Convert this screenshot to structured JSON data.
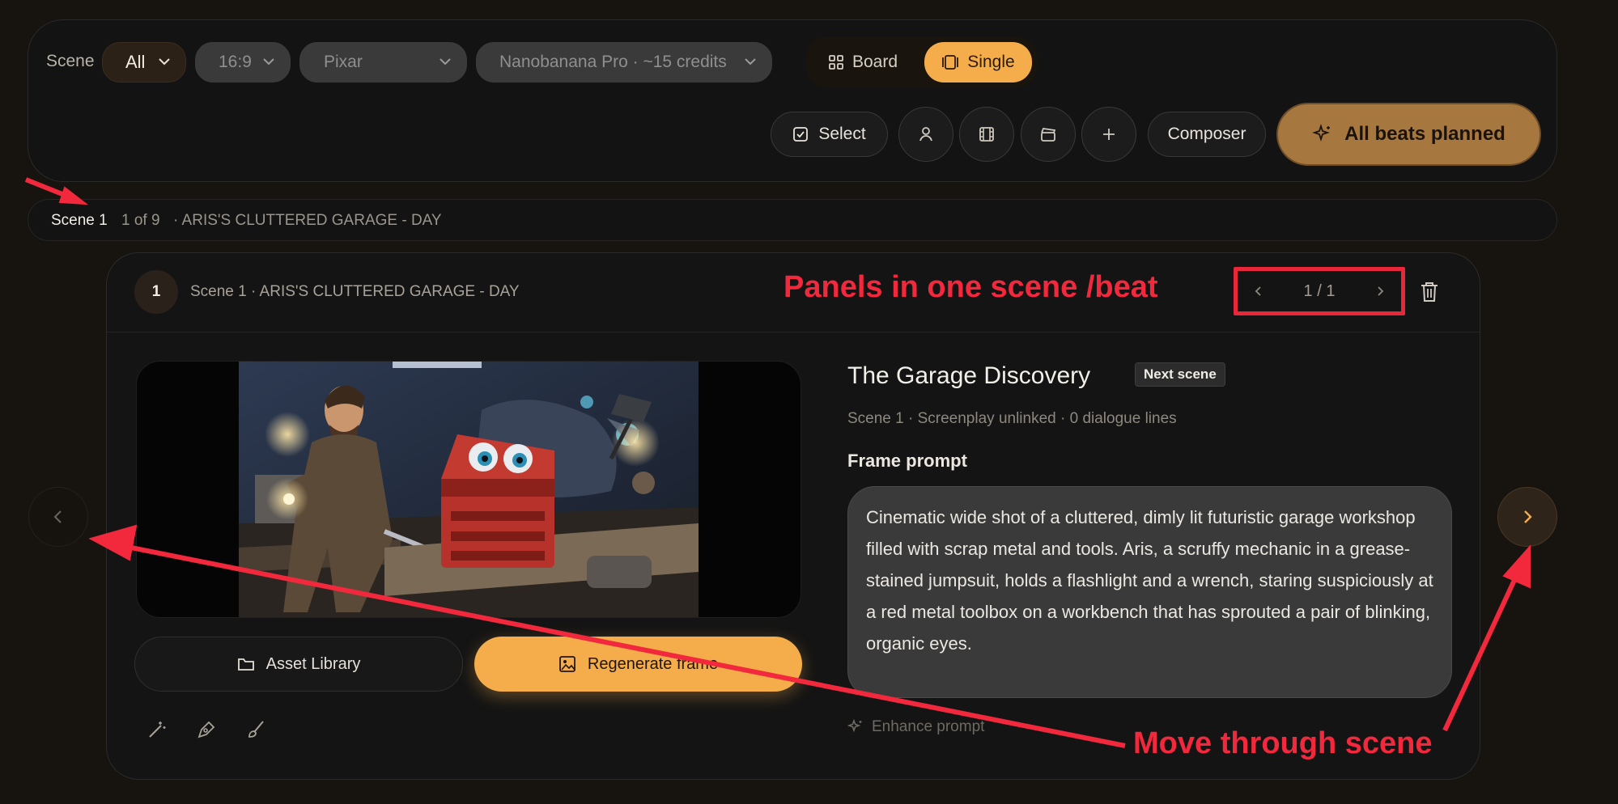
{
  "toolbar": {
    "scene_label": "Scene",
    "filter_all": "All",
    "aspect_ratio": "16:9",
    "style": "Pixar",
    "model": "Nanobanana Pro · ~15 credits",
    "view_board": "Board",
    "view_single": "Single",
    "select_label": "Select",
    "composer_label": "Composer",
    "beats_label": "All beats planned"
  },
  "breadcrumb": {
    "scene": "Scene 1",
    "count": "1 of 9",
    "title": "· ARIS'S CLUTTERED GARAGE - DAY"
  },
  "panel": {
    "number": "1",
    "heading": "Scene 1 · ARIS'S CLUTTERED GARAGE - DAY",
    "pager_current": "1",
    "pager_sep": "/",
    "pager_total": "1",
    "beat_title": "The Garage Discovery",
    "next_badge": "Next scene",
    "meta": "Scene 1 · Screenplay unlinked · 0 dialogue lines",
    "frame_prompt_label": "Frame prompt",
    "frame_prompt": "Cinematic wide shot of a cluttered, dimly lit futuristic garage workshop filled with scrap metal and tools. Aris, a scruffy mechanic in a grease-stained jumpsuit, holds a flashlight and a wrench, staring suspiciously at a red metal toolbox on a workbench that has sprouted a pair of blinking, organic eyes.",
    "enhance_label": "Enhance prompt",
    "asset_library_label": "Asset Library",
    "regenerate_label": "Regenerate frame"
  },
  "annotations": {
    "panels": "Panels in one scene /beat",
    "move": "Move through scene"
  },
  "colors": {
    "accent": "#f4ad4a",
    "annotation": "#f2283c",
    "background": "#17140f"
  }
}
